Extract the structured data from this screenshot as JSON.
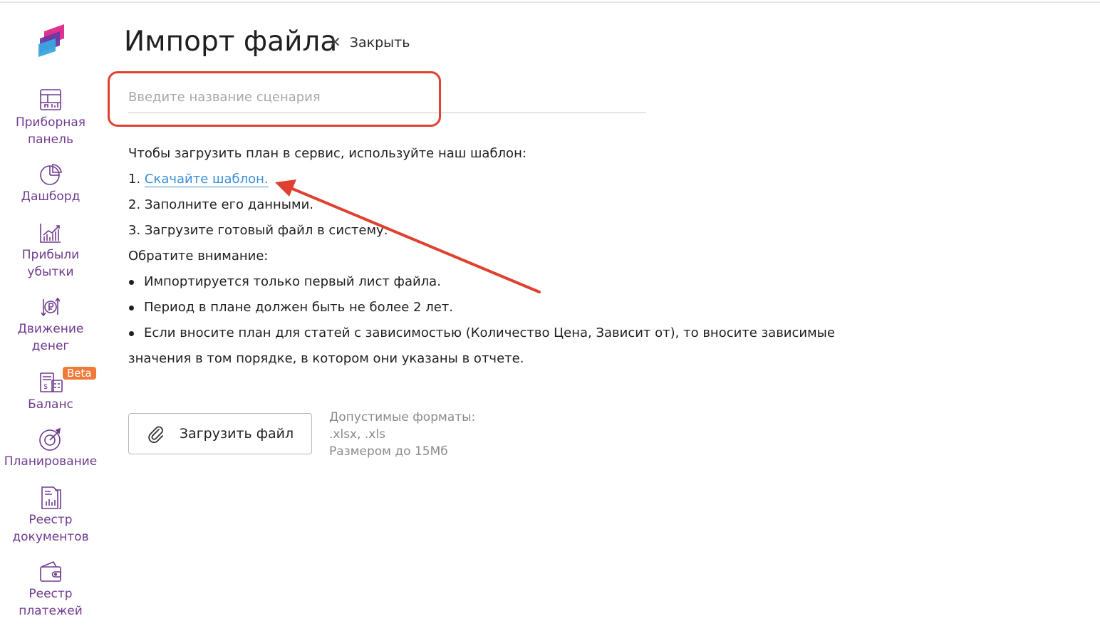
{
  "page": {
    "title": "Импорт файла",
    "close_label": "Закрыть"
  },
  "sidebar": {
    "items": [
      {
        "label": "Приборная панель",
        "icon": "dashboard-panel-icon"
      },
      {
        "label": "Дашборд",
        "icon": "pie-chart-icon"
      },
      {
        "label": "Прибыли убытки",
        "icon": "bar-chart-growth-icon"
      },
      {
        "label": "Движение денег",
        "icon": "ruble-cycle-icon"
      },
      {
        "label": "Баланс",
        "icon": "balance-sheet-icon",
        "badge": "Beta"
      },
      {
        "label": "Планирование",
        "icon": "target-icon"
      },
      {
        "label": "Реестр документов",
        "icon": "document-report-icon"
      },
      {
        "label": "Реестр платежей",
        "icon": "wallet-icon"
      }
    ]
  },
  "scenario": {
    "placeholder": "Введите название сценария",
    "value": ""
  },
  "instructions": {
    "intro": "Чтобы загрузить план в сервис, используйте наш шаблон:",
    "step1_num": "1.",
    "step1_link": "Скачайте шаблон.",
    "step2": "2. Заполните его данными.",
    "step3": "3. Загрузите готовый файл в систему.",
    "note_title": "Обратите внимание:",
    "bullets": [
      "Импортируется только первый лист файла.",
      "Период в плане должен быть не более 2 лет.",
      "Если вносите план для статей с зависимостью (Количество Цена, Зависит от), то вносите зависимые значения в том порядке, в котором они указаны в отчете."
    ]
  },
  "upload": {
    "button_label": "Загрузить файл",
    "formats_title": "Допустимые форматы:",
    "formats_list": ".xlsx, .xls",
    "size_limit": "Размером до 15Мб"
  },
  "colors": {
    "sidebar_text": "#6f3b8f",
    "link": "#3a8fd6",
    "annotation": "#e0402f",
    "badge": "#f07a3a"
  }
}
